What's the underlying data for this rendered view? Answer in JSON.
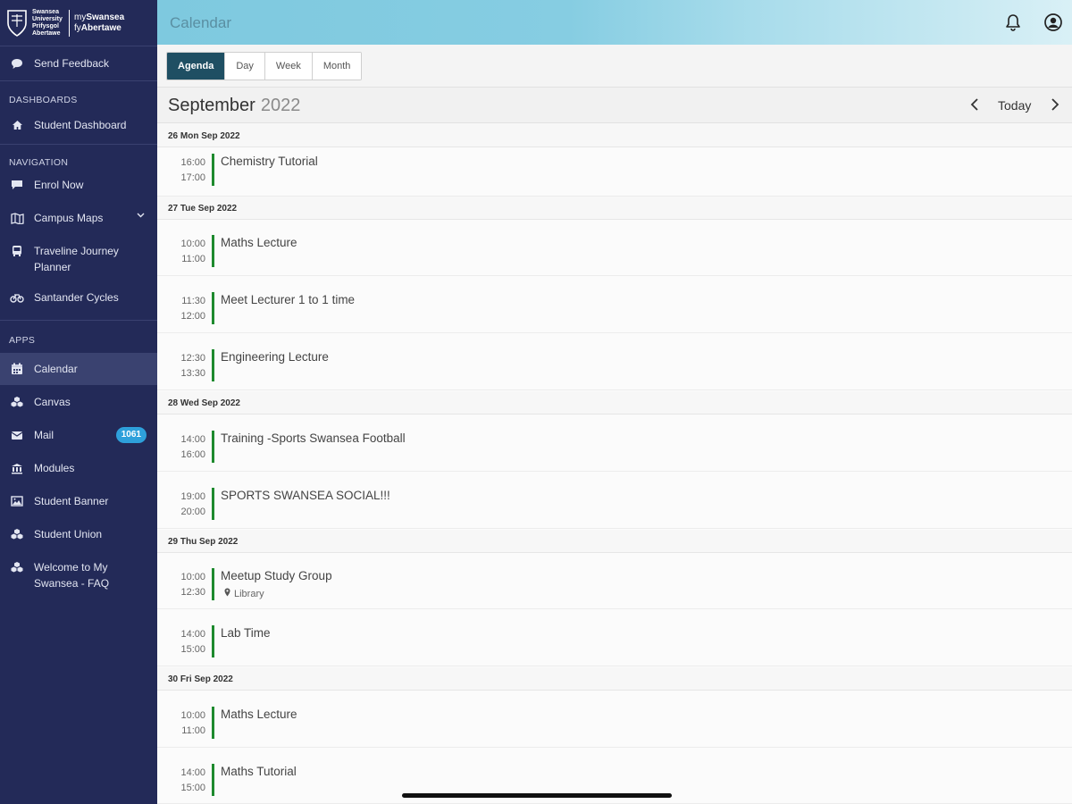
{
  "brand": {
    "university_lines": [
      "Swansea",
      "University",
      "Prifysgol",
      "Abertawe"
    ],
    "app_line1_prefix": "my",
    "app_line1_bold": "Swansea",
    "app_line2_prefix": "fy",
    "app_line2_bold": "Abertawe"
  },
  "sidebar": {
    "feedback": "Send Feedback",
    "dashboards_heading": "DASHBOARDS",
    "student_dashboard": "Student Dashboard",
    "navigation_heading": "NAVIGATION",
    "enrol_now": "Enrol Now",
    "campus_maps": "Campus Maps",
    "traveline_line1": "Traveline Journey",
    "traveline_line2": "Planner",
    "santander": "Santander Cycles",
    "apps_heading": "APPS",
    "calendar": "Calendar",
    "canvas": "Canvas",
    "mail": "Mail",
    "mail_badge": "1061",
    "modules": "Modules",
    "student_banner": "Student Banner",
    "student_union": "Student Union",
    "faq_line1": "Welcome to My",
    "faq_line2": "Swansea - FAQ"
  },
  "header": {
    "title": "Calendar"
  },
  "views": [
    "Agenda",
    "Day",
    "Week",
    "Month"
  ],
  "month_header": {
    "month": "September",
    "year": "2022",
    "today": "Today"
  },
  "agenda": [
    {
      "date": "26 Mon Sep 2022",
      "events": [
        {
          "start": "16:00",
          "end": "17:00",
          "title": "Chemistry Tutorial"
        }
      ]
    },
    {
      "date": "27 Tue Sep 2022",
      "events": [
        {
          "start": "10:00",
          "end": "11:00",
          "title": "Maths Lecture"
        },
        {
          "start": "11:30",
          "end": "12:00",
          "title": "Meet Lecturer 1 to 1 time"
        },
        {
          "start": "12:30",
          "end": "13:30",
          "title": "Engineering Lecture"
        }
      ]
    },
    {
      "date": "28 Wed Sep 2022",
      "events": [
        {
          "start": "14:00",
          "end": "16:00",
          "title": "Training -Sports Swansea Football"
        },
        {
          "start": "19:00",
          "end": "20:00",
          "title": "SPORTS SWANSEA SOCIAL!!!"
        }
      ]
    },
    {
      "date": "29 Thu Sep 2022",
      "events": [
        {
          "start": "10:00",
          "end": "12:30",
          "title": "Meetup Study Group",
          "location": "Library"
        },
        {
          "start": "14:00",
          "end": "15:00",
          "title": "Lab Time"
        }
      ]
    },
    {
      "date": "30 Fri Sep 2022",
      "events": [
        {
          "start": "10:00",
          "end": "11:00",
          "title": "Maths Lecture"
        },
        {
          "start": "14:00",
          "end": "15:00",
          "title": "Maths Tutorial"
        }
      ]
    }
  ],
  "colors": {
    "sidebar": "#232a58",
    "event_bar": "#1e8a2e",
    "active_view": "#1f4f63",
    "badge": "#2ea0db"
  }
}
